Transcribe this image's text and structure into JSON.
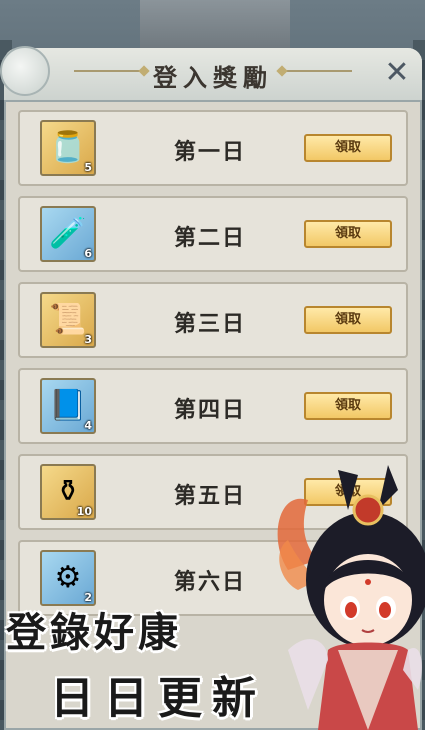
{
  "header": {
    "title": "登入獎勵",
    "close_icon": "close-icon"
  },
  "rewards": [
    {
      "day": "第一日",
      "qty": "5",
      "icon": "blue-gourd-icon",
      "frame": "gold",
      "claim": "領取"
    },
    {
      "day": "第二日",
      "qty": "6",
      "icon": "potion-bottle-icon",
      "frame": "blue",
      "claim": "領取"
    },
    {
      "day": "第三日",
      "qty": "3",
      "icon": "scroll-icon",
      "frame": "gold",
      "claim": "領取"
    },
    {
      "day": "第四日",
      "qty": "4",
      "icon": "blue-book-icon",
      "frame": "blue",
      "claim": "領取"
    },
    {
      "day": "第五日",
      "qty": "10",
      "icon": "elixir-flask-icon",
      "frame": "gold",
      "claim": "領取"
    },
    {
      "day": "第六日",
      "qty": "2",
      "icon": "gear-ore-icon",
      "frame": "blue",
      "claim": ""
    }
  ],
  "banner": {
    "line1": "登錄好康",
    "line2": "日日更新"
  },
  "colors": {
    "panel": "#d9d6cc",
    "button": "#f2c866",
    "accent": "#b8862e"
  }
}
